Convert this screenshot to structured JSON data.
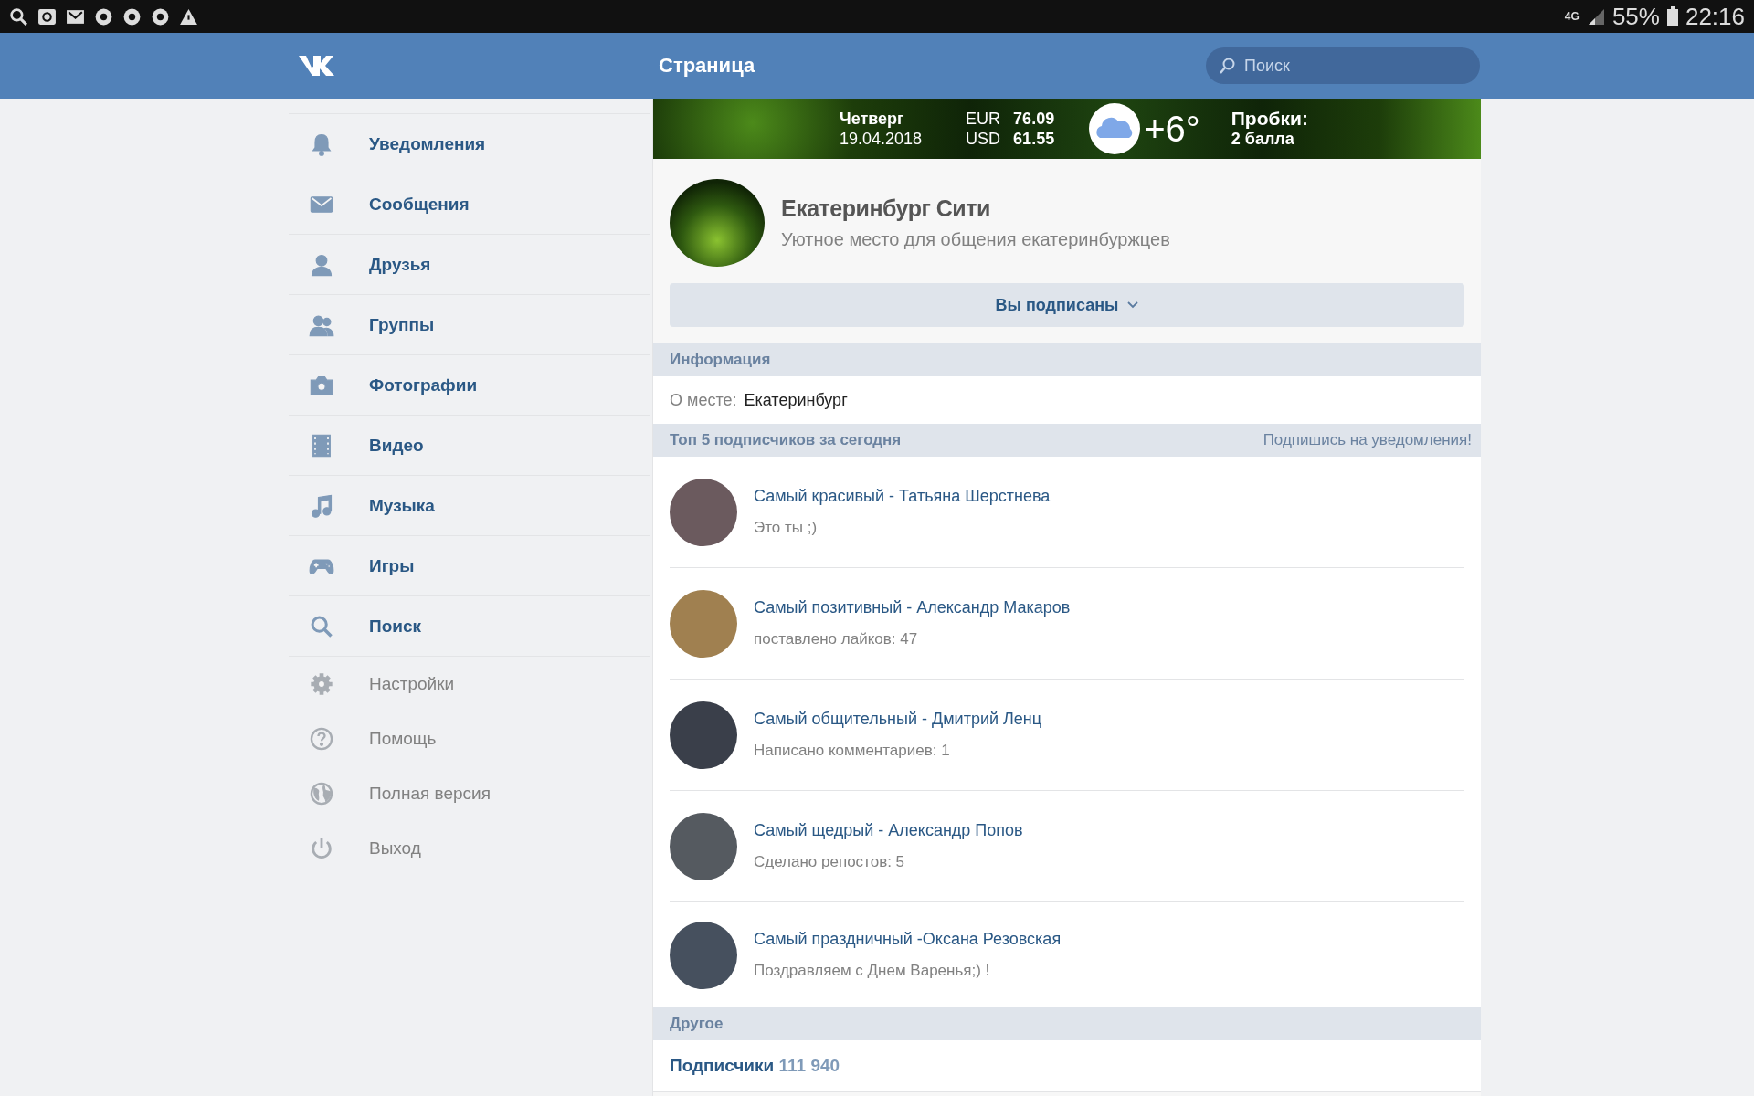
{
  "status_bar": {
    "network": "4G",
    "battery": "55%",
    "time": "22:16"
  },
  "header": {
    "title": "Страница",
    "search": {
      "placeholder": "Поиск"
    }
  },
  "sidebar": {
    "items": [
      {
        "label": "Уведомления",
        "kind": "primary"
      },
      {
        "label": "Сообщения",
        "kind": "primary"
      },
      {
        "label": "Друзья",
        "kind": "primary"
      },
      {
        "label": "Группы",
        "kind": "primary"
      },
      {
        "label": "Фотографии",
        "kind": "primary"
      },
      {
        "label": "Видео",
        "kind": "primary"
      },
      {
        "label": "Музыка",
        "kind": "primary"
      },
      {
        "label": "Игры",
        "kind": "primary"
      },
      {
        "label": "Поиск",
        "kind": "primary"
      },
      {
        "label": "Настройки",
        "kind": "secondary"
      },
      {
        "label": "Помощь",
        "kind": "secondary"
      },
      {
        "label": "Полная версия",
        "kind": "secondary"
      },
      {
        "label": "Выход",
        "kind": "secondary"
      }
    ]
  },
  "banner": {
    "day": "Четверг",
    "date": "19.04.2018",
    "rates": [
      {
        "currency": "EUR",
        "value": "76.09"
      },
      {
        "currency": "USD",
        "value": "61.55"
      }
    ],
    "temperature": "+6°",
    "traffic_label": "Пробки:",
    "traffic_value": "2 балла"
  },
  "group": {
    "name": "Екатеринбург Сити",
    "description": "Уютное место для общения екатеринбуржцев",
    "subscribe_button": "Вы подписаны"
  },
  "info": {
    "title": "Информация",
    "label": "О месте:",
    "value": "Екатеринбург"
  },
  "top": {
    "title": "Топ 5 подписчиков за сегодня",
    "link": "Подпишись на уведомления!",
    "members": [
      {
        "title": "Самый красивый - Татьяна Шерстнева",
        "subtitle": "Это ты ;)"
      },
      {
        "title": "Самый позитивный - Александр Макаров",
        "subtitle": "поставлено лайков: 47"
      },
      {
        "title": "Самый общительный - Дмитрий Ленц",
        "subtitle": "Написано комментариев: 1"
      },
      {
        "title": "Самый щедрый - Александр Попов",
        "subtitle": "Сделано репостов: 5"
      },
      {
        "title": "Самый праздничный -Оксана Резовская",
        "subtitle": "Поздравляем с Днем Варенья;) !"
      }
    ]
  },
  "other": {
    "title": "Другое",
    "subscribers_label": "Подписчики",
    "subscribers_count": "111 940"
  }
}
